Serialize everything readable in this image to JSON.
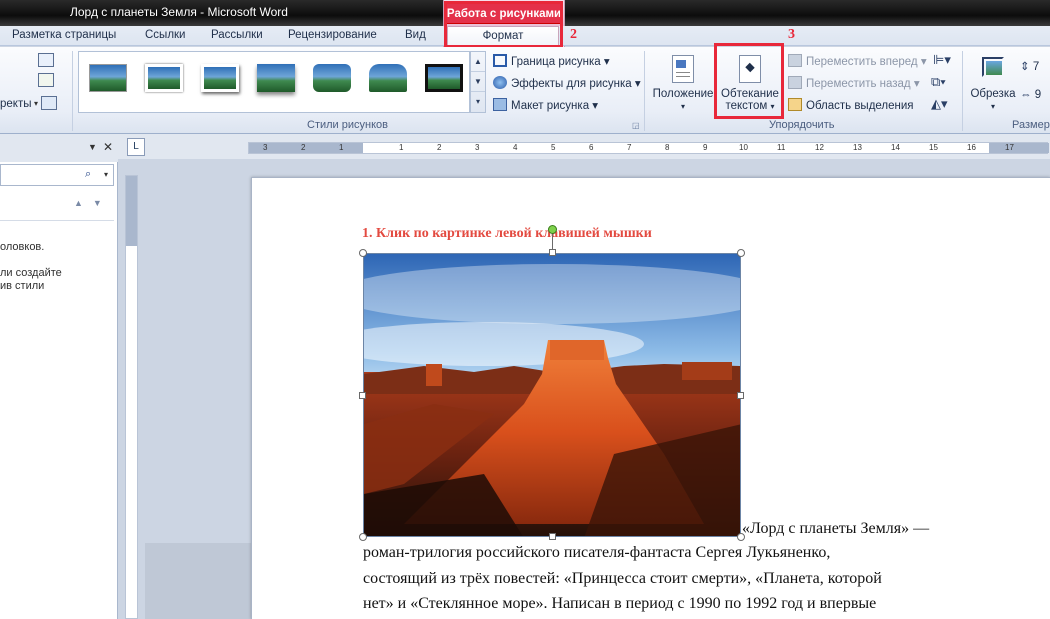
{
  "window": {
    "title": "Лорд с планеты Земля  -  Microsoft Word"
  },
  "tabs": [
    {
      "label": "Разметка страницы"
    },
    {
      "label": "Ссылки"
    },
    {
      "label": "Рассылки"
    },
    {
      "label": "Рецензирование"
    },
    {
      "label": "Вид"
    }
  ],
  "contextual": {
    "group_title": "Работа с рисунками",
    "format_tab": "Формат"
  },
  "annotations": {
    "step2": "2",
    "step3": "3",
    "color": "#e8283a"
  },
  "ribbon": {
    "left_partial": "ректы",
    "picture_styles_group": "Стили рисунков",
    "picture_border": "Граница рисунка",
    "picture_effects": "Эффекты для рисунка",
    "picture_layout": "Макет рисунка",
    "position_label": "Положение",
    "wrap_text_line1": "Обтекание",
    "wrap_text_line2": "текстом",
    "bring_forward": "Переместить вперед",
    "send_backward": "Переместить назад",
    "selection_pane": "Область выделения",
    "arrange_group": "Упорядочить",
    "crop_label": "Обрезка",
    "size_group": "Размер",
    "height_partial": "7",
    "width_partial": "9"
  },
  "ruler": {
    "ticks": [
      "3",
      "2",
      "1",
      "1",
      "2",
      "3",
      "4",
      "5",
      "6",
      "7",
      "8",
      "9",
      "10",
      "11",
      "12",
      "13",
      "14",
      "15",
      "16",
      "17"
    ],
    "tab_selector": "L"
  },
  "nav_pane": {
    "text1": "оловков.",
    "text2": "ли создайте",
    "text3": "ив стили"
  },
  "document": {
    "heading": "1. Клик по картинке левой клавишей мышки",
    "lines": [
      "«Лорд  с  планеты  Земля» —",
      "роман-трилогия российского писателя-фантаста Сергея            Лукьяненко,",
      "состоящий из трёх повестей: «Принцесса стоит смерти», «Планета, которой",
      "нет» и «Стеклянное море». Написан в период с 1990 по 1992 год и впервые"
    ]
  }
}
